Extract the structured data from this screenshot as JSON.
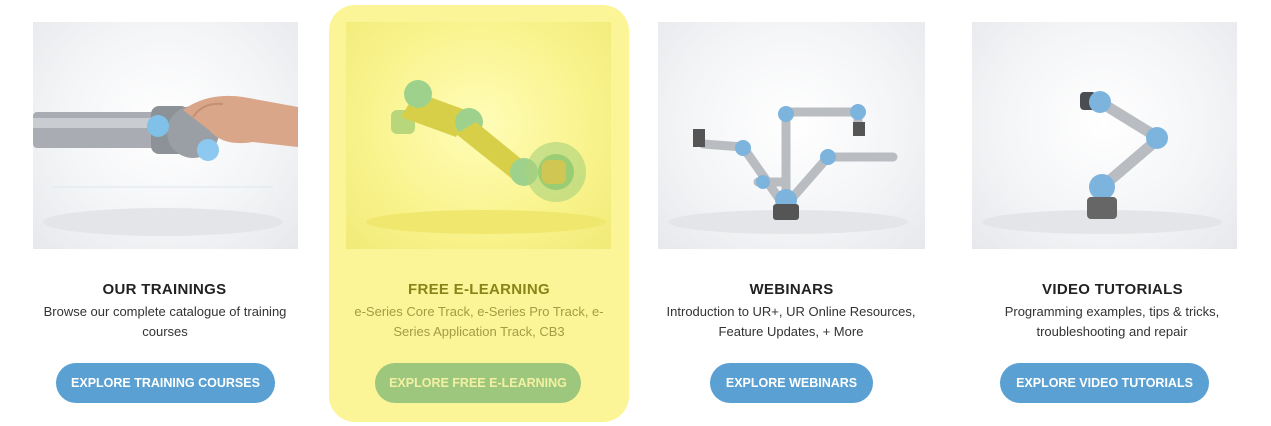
{
  "cards": [
    {
      "title": "OUR TRAININGS",
      "description": "Browse our complete catalogue of training courses",
      "button_label": "EXPLORE TRAINING COURSES"
    },
    {
      "title": "FREE E-LEARNING",
      "description": "e-Series Core Track, e-Series Pro Track, e-Series Application Track, CB3",
      "button_label": "EXPLORE FREE E-LEARNING",
      "highlighted": true
    },
    {
      "title": "WEBINARS",
      "description": "Introduction to UR+, UR Online Resources, Feature Updates, + More",
      "button_label": "EXPLORE WEBINARS"
    },
    {
      "title": "VIDEO TUTORIALS",
      "description": "Programming examples, tips & tricks, troubleshooting and repair",
      "button_label": "EXPLORE VIDEO TUTORIALS"
    }
  ],
  "colors": {
    "button": "#5aa0d2",
    "highlight_background": "#fbf598",
    "highlight_button": "#9ec77e",
    "highlight_title": "#8a8418"
  }
}
